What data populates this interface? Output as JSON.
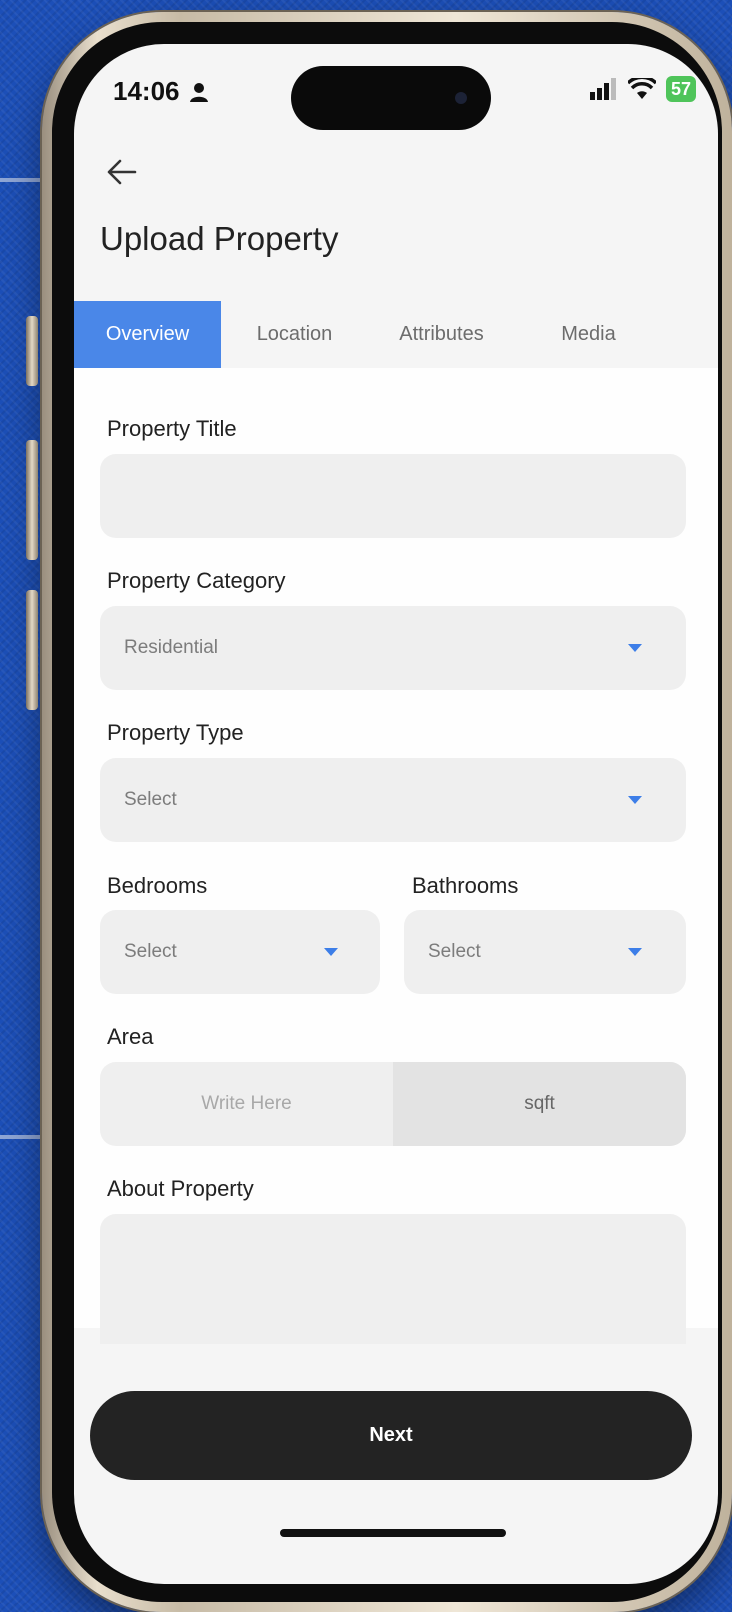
{
  "status_bar": {
    "time": "14:06",
    "battery": "57"
  },
  "header": {
    "title": "Upload Property"
  },
  "tabs": [
    {
      "label": "Overview",
      "active": true
    },
    {
      "label": "Location",
      "active": false
    },
    {
      "label": "Attributes",
      "active": false
    },
    {
      "label": "Media",
      "active": false
    }
  ],
  "form": {
    "property_title": {
      "label": "Property Title",
      "value": ""
    },
    "property_category": {
      "label": "Property Category",
      "value": "Residential"
    },
    "property_type": {
      "label": "Property Type",
      "value": "Select"
    },
    "bedrooms": {
      "label": "Bedrooms",
      "value": "Select"
    },
    "bathrooms": {
      "label": "Bathrooms",
      "value": "Select"
    },
    "area": {
      "label": "Area",
      "placeholder": "Write Here",
      "unit": "sqft"
    },
    "about": {
      "label": "About Property",
      "value": ""
    }
  },
  "next_button": {
    "label": "Next"
  },
  "colors": {
    "accent": "#4a87e8",
    "dark_button": "#232323",
    "field_bg": "#efefef"
  }
}
